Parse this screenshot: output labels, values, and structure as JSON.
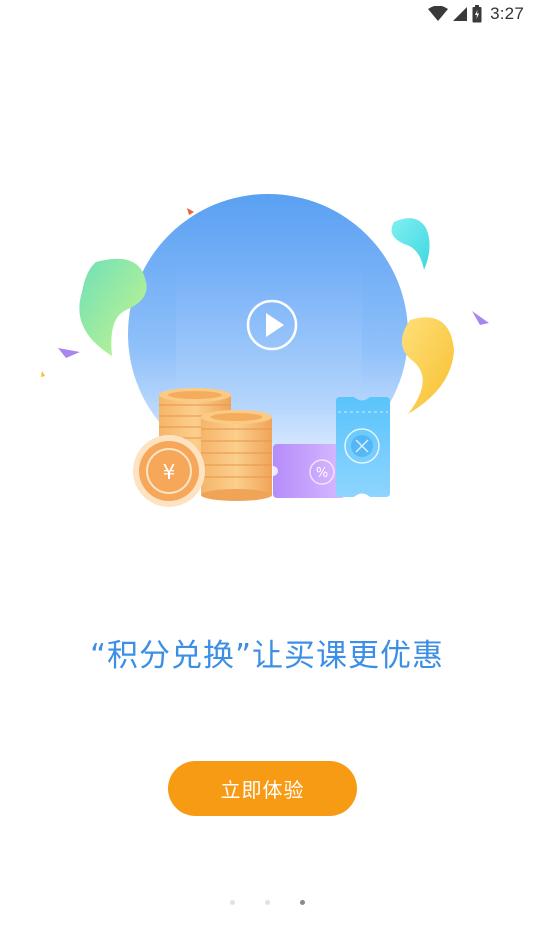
{
  "status_bar": {
    "time": "3:27",
    "icons": [
      "wifi-icon",
      "cell-signal-icon",
      "battery-icon"
    ]
  },
  "illustration": {
    "coin_symbol": "¥",
    "coupon_symbol": "%",
    "icons": [
      "play-icon",
      "coin-icon",
      "coupon-icon",
      "ticket-icon"
    ]
  },
  "headline": "“积分兑换”让买课更优惠",
  "cta_label": "立即体验",
  "pagination": {
    "total": 3,
    "active_index": 2
  },
  "colors": {
    "headline": "#3d8fe6",
    "cta_background": "#f79a14",
    "circle_top": "#5aa0f2",
    "circle_bottom": "#dbeaff"
  }
}
